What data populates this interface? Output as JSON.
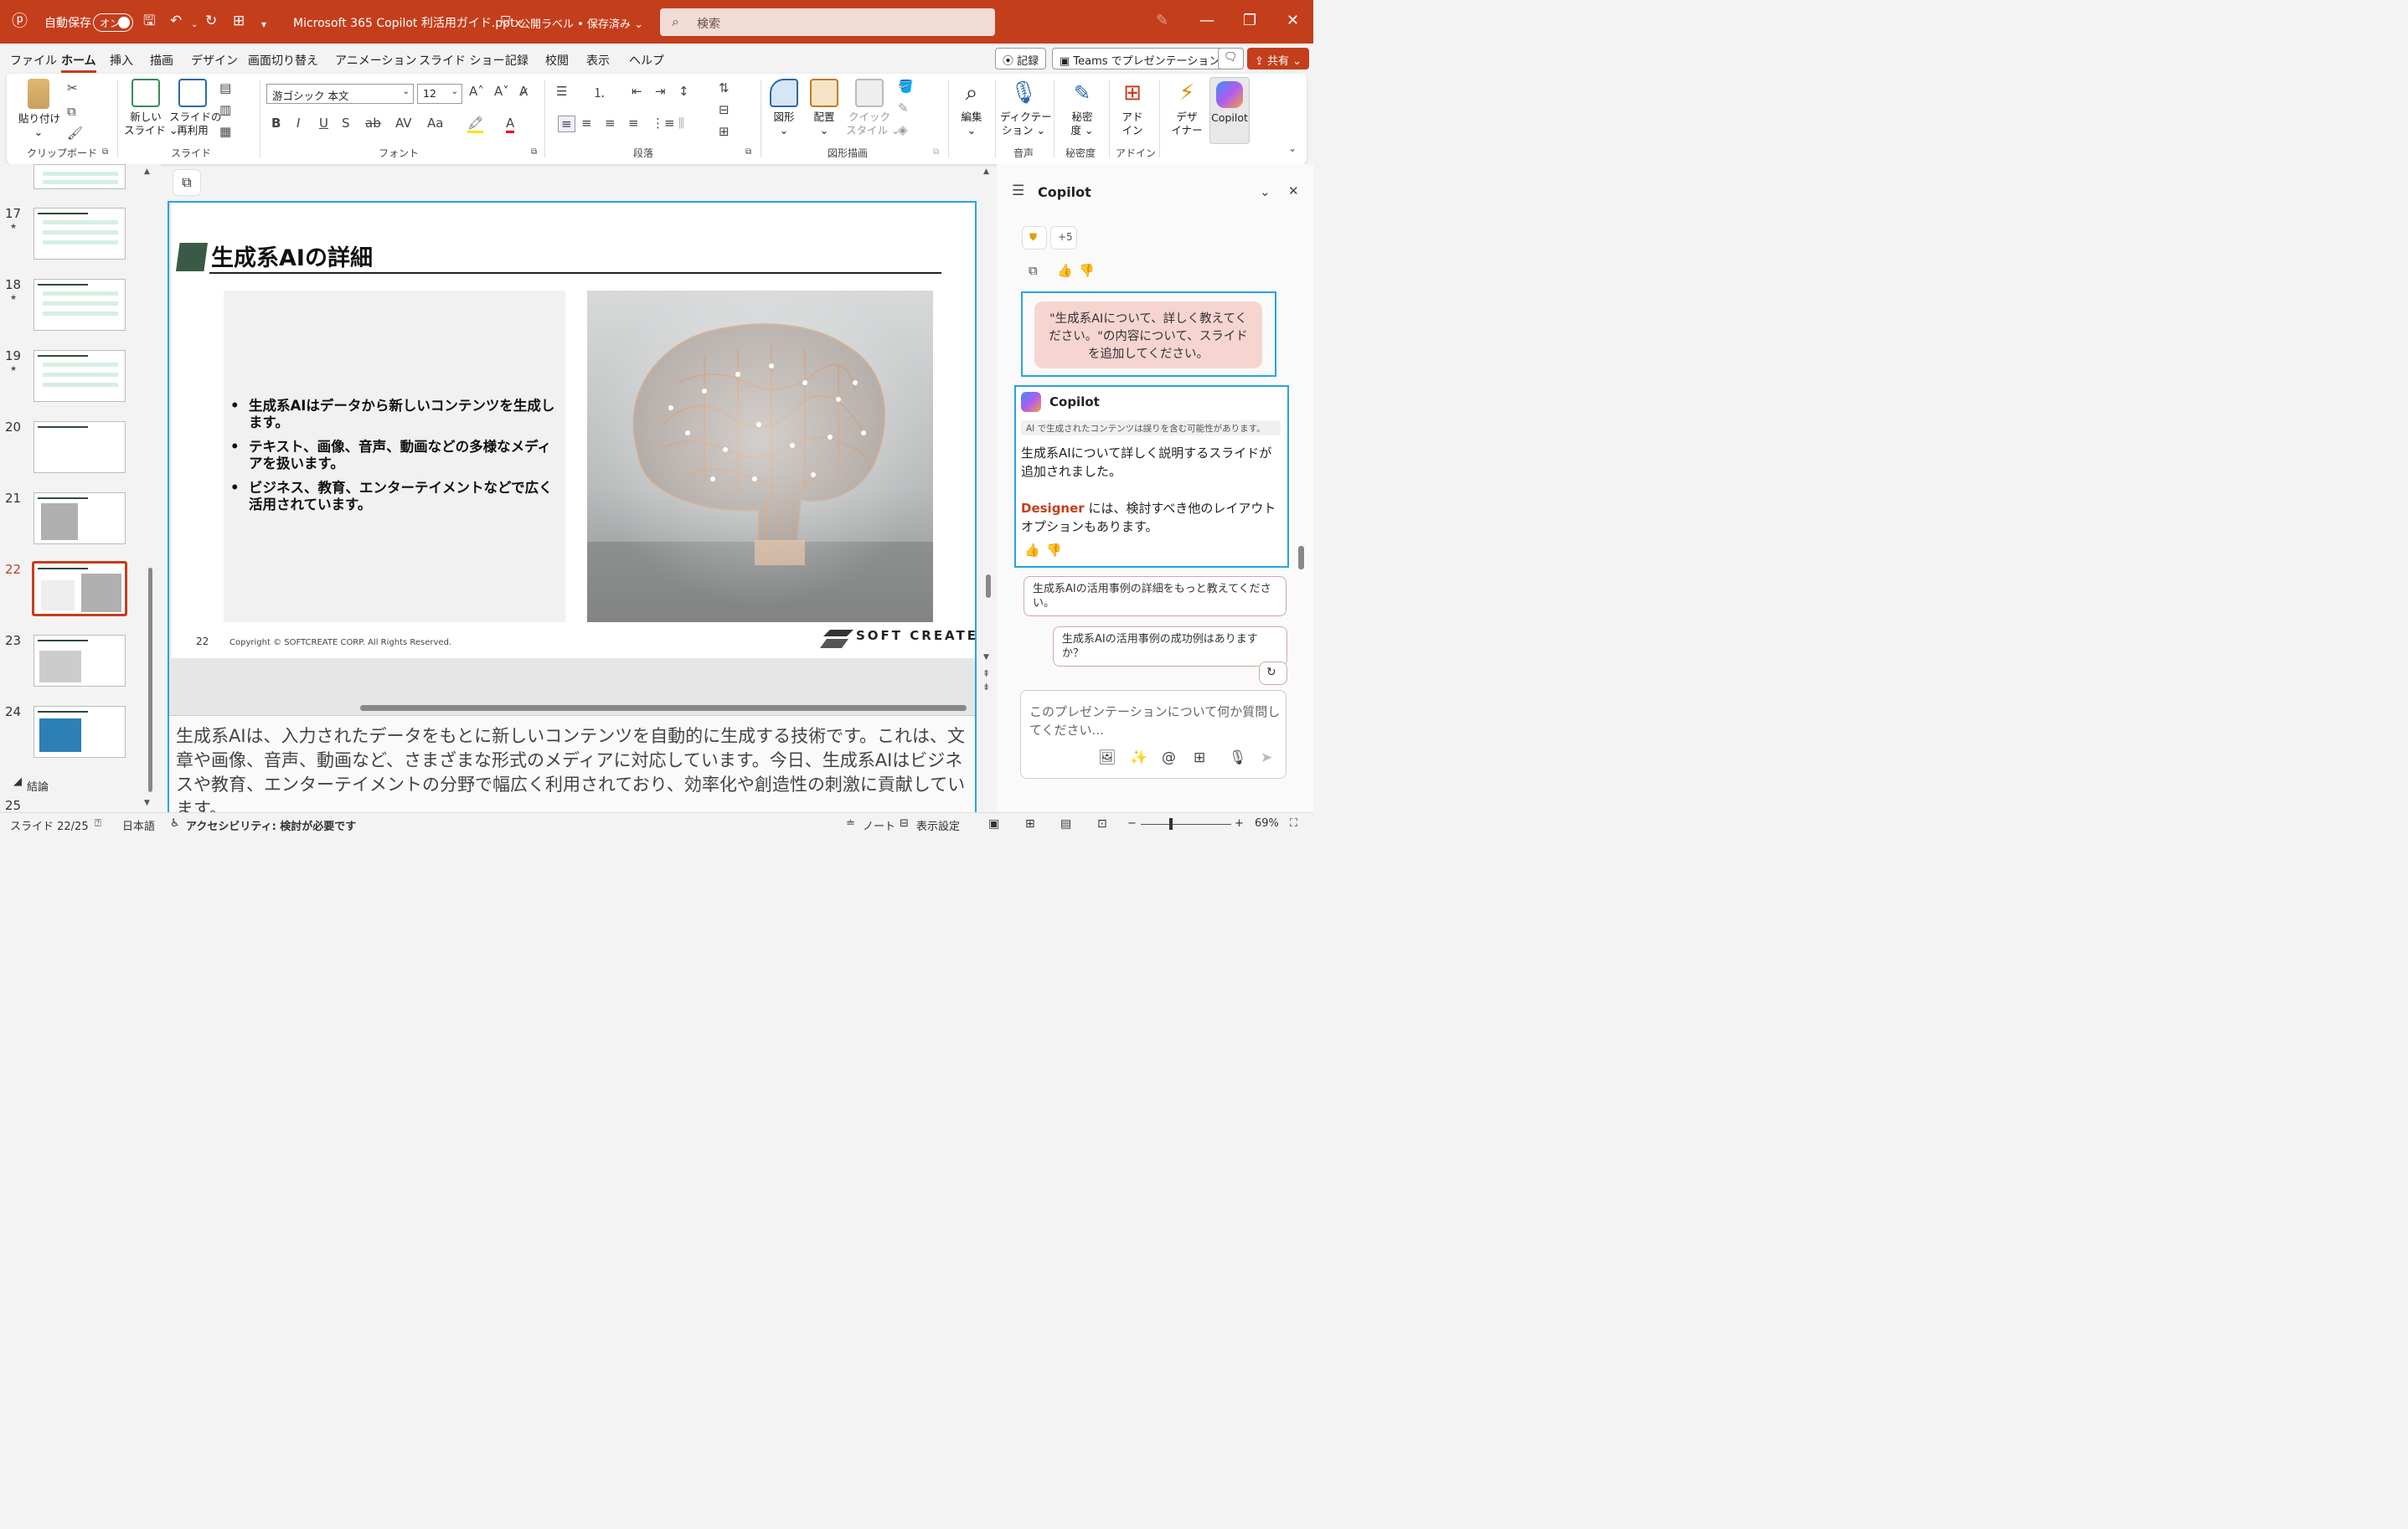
{
  "titlebar": {
    "autosave_label": "自動保存",
    "autosave_state": "オン",
    "filename": "Microsoft 365 Copilot 利活用ガイド.pptx",
    "label_status": "公開ラベル • 保存済み ⌄",
    "search_placeholder": "検索"
  },
  "menu": {
    "items": [
      "ファイル",
      "ホーム",
      "挿入",
      "描画",
      "デザイン",
      "画面切り替え",
      "アニメーション",
      "スライド ショー",
      "記録",
      "校閲",
      "表示",
      "ヘルプ"
    ],
    "active": "ホーム",
    "record_button": "記録",
    "teams_button": "Teams でプレゼンテーション",
    "share_button": "共有 ⌄"
  },
  "ribbon": {
    "paste": "貼り付け",
    "new_slide": [
      "新しい",
      "スライド ⌄"
    ],
    "reuse_slide": [
      "スライドの",
      "再利用"
    ],
    "font_name": "游ゴシック 本文",
    "font_size": "12",
    "shapes": "図形",
    "arrange": "配置",
    "quick_style": [
      "クイック",
      "スタイル ⌄"
    ],
    "edit": "編集",
    "dictate": [
      "ディクテー",
      "ション ⌄"
    ],
    "sensitivity": [
      "秘密",
      "度 ⌄"
    ],
    "addins": [
      "アド",
      "イン"
    ],
    "designer": [
      "デザ",
      "イナー"
    ],
    "copilot": "Copilot",
    "groups": [
      "クリップボード",
      "スライド",
      "フォント",
      "段落",
      "図形描画",
      "音声",
      "秘密度",
      "アドイン"
    ]
  },
  "thumbnails": {
    "numbers": [
      "17",
      "18",
      "19",
      "20",
      "21",
      "22",
      "23",
      "24",
      "25"
    ],
    "selected": "22",
    "section_label": "結論"
  },
  "slide": {
    "title": "生成系AIの詳細",
    "bullets": [
      "生成系AIはデータから新しいコンテンツを生成します。",
      "テキスト、画像、音声、動画などの多様なメディアを扱います。",
      "ビジネス、教育、エンターテイメントなどで広く活用されています。"
    ],
    "page_number": "22",
    "copyright": "Copyright © SOFTCREATE CORP. All Rights Reserved.",
    "logo_text": "SOFT CREATE"
  },
  "notes": {
    "text": "生成系AIは、入力されたデータをもとに新しいコンテンツを自動的に生成する技術です。これは、文章や画像、音声、動画など、さまざまな形式のメディアに対応しています。今日、生成系AIはビジネスや教育、エンターテイメントの分野で幅広く利用されており、効率化や創造性の刺激に貢献しています。"
  },
  "copilot": {
    "title": "Copilot",
    "chip_more": "+5",
    "user_message": "\"生成系AIについて、詳しく教えてください。\"の内容について、スライドを追加してください。",
    "ai_name": "Copilot",
    "disclaimer": "AI で生成されたコンテンツは誤りを含む可能性があります。",
    "ai_reply_1": "生成系AIについて詳しく説明するスライドが追加されました。",
    "ai_reply_2_accent": "Designer",
    "ai_reply_2_rest": " には、検討すべき他のレイアウト オプションもあります。",
    "suggestions": [
      "生成系AIの活用事例の詳細をもっと教えてください。",
      "生成系AIの活用事例の成功例はありますか？"
    ],
    "input_placeholder": "このプレゼンテーションについて何か質問してください..."
  },
  "status": {
    "slide_position": "スライド 22/25",
    "language": "日本語",
    "accessibility": "アクセシビリティ: 検討が必要です",
    "notes": "ノート",
    "view_settings": "表示設定",
    "zoom": "69%"
  },
  "colors": {
    "accent": "#c43e1c",
    "selection": "#2aa3de",
    "slide_title_flag": "#3a5a48"
  }
}
